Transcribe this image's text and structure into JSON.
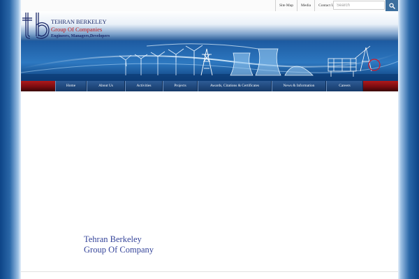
{
  "topbar": {
    "links": [
      "Site Map",
      "Media",
      "Contact Us"
    ],
    "search_placeholder": "Search",
    "search_icon": "magnifier-icon"
  },
  "header": {
    "logo_letters": "tb",
    "title": "TEHRAN BERKELEY",
    "subtitle": "Group Of Companies",
    "tagline": "Engineers, Managers,Developers"
  },
  "banner": {
    "theme": "energy infrastructure: wind turbines, power pylons, cooling towers, refinery"
  },
  "nav": {
    "items": [
      "Home",
      "About Us",
      "Activities",
      "Projects",
      "Awards, Citations & Certificates",
      "News & Information",
      "Careers"
    ]
  },
  "content": {
    "title_line1": "Tehran Berkeley",
    "title_line2": "Group Of Company"
  },
  "colors": {
    "brand_navy": "#1c2a6a",
    "brand_red": "#c41818",
    "nav_blue": "#214a7f",
    "nav_red": "#7a0c10",
    "page_side_blue": "#0d4487",
    "content_text": "#35449a"
  }
}
